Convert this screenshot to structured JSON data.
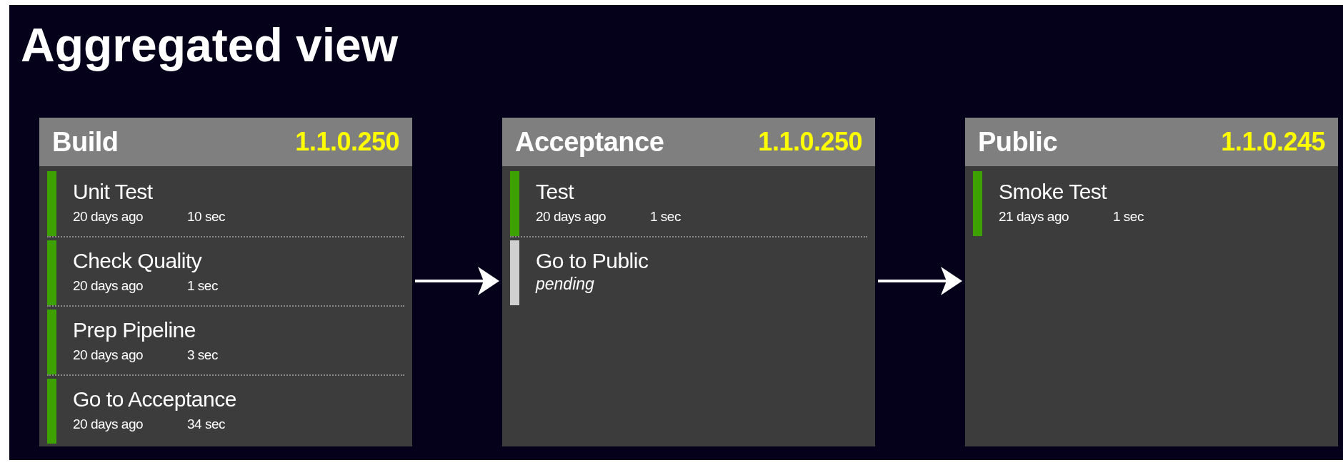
{
  "title": "Aggregated view",
  "stages": [
    {
      "name": "Build",
      "version": "1.1.0.250",
      "jobs": [
        {
          "name": "Unit Test",
          "kind": "passed",
          "age": "20 days ago",
          "duration": "10 sec"
        },
        {
          "name": "Check Quality",
          "kind": "passed",
          "age": "20 days ago",
          "duration": "1 sec"
        },
        {
          "name": "Prep Pipeline",
          "kind": "passed",
          "age": "20 days ago",
          "duration": "3 sec"
        },
        {
          "name": "Go to Acceptance",
          "kind": "passed",
          "age": "20 days ago",
          "duration": "34 sec"
        }
      ]
    },
    {
      "name": "Acceptance",
      "version": "1.1.0.250",
      "jobs": [
        {
          "name": "Test",
          "kind": "passed",
          "age": "20 days ago",
          "duration": "1 sec"
        },
        {
          "name": "Go to Public",
          "kind": "queued",
          "note": "pending"
        }
      ]
    },
    {
      "name": "Public",
      "version": "1.1.0.245",
      "jobs": [
        {
          "name": "Smoke Test",
          "kind": "passed",
          "age": "21 days ago",
          "duration": "1 sec"
        }
      ]
    }
  ]
}
